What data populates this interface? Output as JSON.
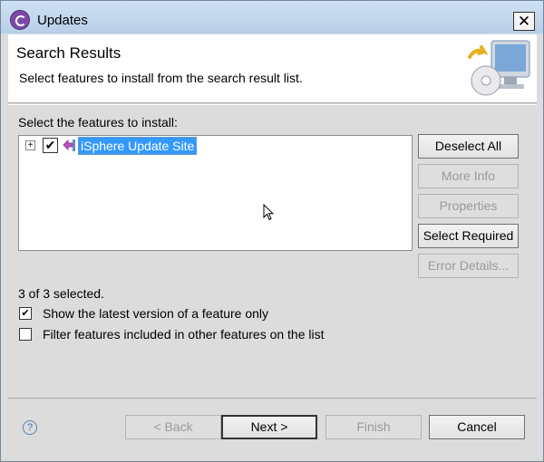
{
  "window": {
    "title": "Updates",
    "close_glyph": "✕"
  },
  "header": {
    "title": "Search Results",
    "subtitle": "Select features to install from the search result list."
  },
  "features": {
    "list_label": "Select the features to install:",
    "items": [
      {
        "label": "iSphere Update Site",
        "checked": true,
        "expanded": false
      }
    ]
  },
  "side_buttons": {
    "deselect_all": "Deselect All",
    "more_info": "More Info",
    "properties": "Properties",
    "select_required": "Select Required",
    "error_details": "Error Details..."
  },
  "status": {
    "selected_count": "3 of 3 selected."
  },
  "options": {
    "latest_version": {
      "label": "Show the latest version of a feature only",
      "checked": true
    },
    "filter_included": {
      "label": "Filter features included in other features on the list",
      "checked": false
    }
  },
  "footer": {
    "help_glyph": "?",
    "back": "< Back",
    "next": "Next >",
    "finish": "Finish",
    "cancel": "Cancel"
  },
  "icons": {
    "app": "eclipse-update-icon",
    "wizard": "computer-cd-update-icon",
    "feature": "update-site-icon",
    "help": "help-icon",
    "cursor": "mouse-pointer-icon"
  },
  "colors": {
    "selection": "#3399ff",
    "title_bar": "#cfe0f2",
    "accent_link": "#3e6fa8"
  }
}
